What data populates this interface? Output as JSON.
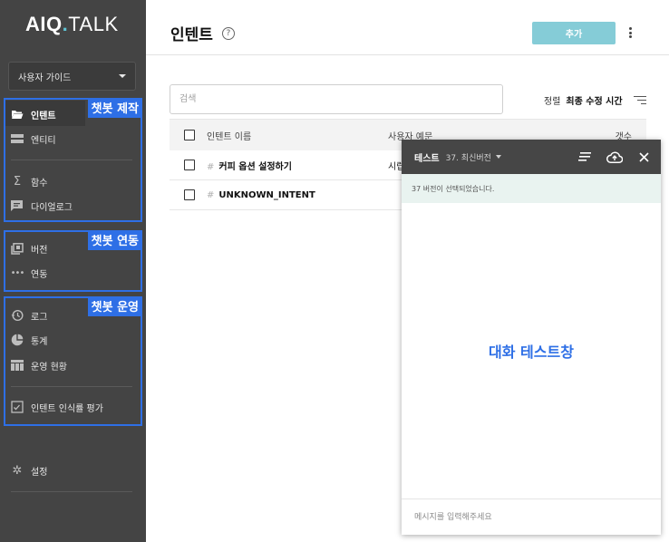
{
  "app": {
    "logo_bold": "AIQ",
    "logo_dot": ".",
    "logo_light": "TALK",
    "brand_accent": "#5fc3d3",
    "annotation_color": "#2e6fe6"
  },
  "sidebar": {
    "guide_select": "사용자 가이드",
    "groups": {
      "build": "챗봇 제작",
      "integrate": "챗봇 연동",
      "operate": "챗봇 운영"
    },
    "items": {
      "intent": "인텐트",
      "entity": "엔티티",
      "function": "함수",
      "dialog_log": "다이얼로그",
      "version": "버전",
      "integration": "연동",
      "log": "로그",
      "stats": "통계",
      "ops_status": "운영 현황",
      "intent_eval": "인텐트 인식률 평가",
      "settings": "설정"
    }
  },
  "header": {
    "title": "인텐트",
    "help_icon": "?",
    "add_button": "추가"
  },
  "search": {
    "placeholder": "검색"
  },
  "sort": {
    "label": "정렬",
    "value": "최종 수정 시간"
  },
  "table": {
    "headers": {
      "name": "인텐트 이름",
      "example": "사용자 예문",
      "count": "갯수"
    },
    "rows": [
      {
        "hash": "#",
        "name": "커피 옵션 설정하기",
        "example": "시럽"
      },
      {
        "hash": "#",
        "name": "UNKNOWN_INTENT",
        "example": ""
      }
    ]
  },
  "test_panel": {
    "title": "테스트",
    "version": "37. 최신버전",
    "notice": "37 버전이 선택되었습니다.",
    "chat_label": "대화 테스트창",
    "input_placeholder": "메시지를 입력해주세요"
  }
}
